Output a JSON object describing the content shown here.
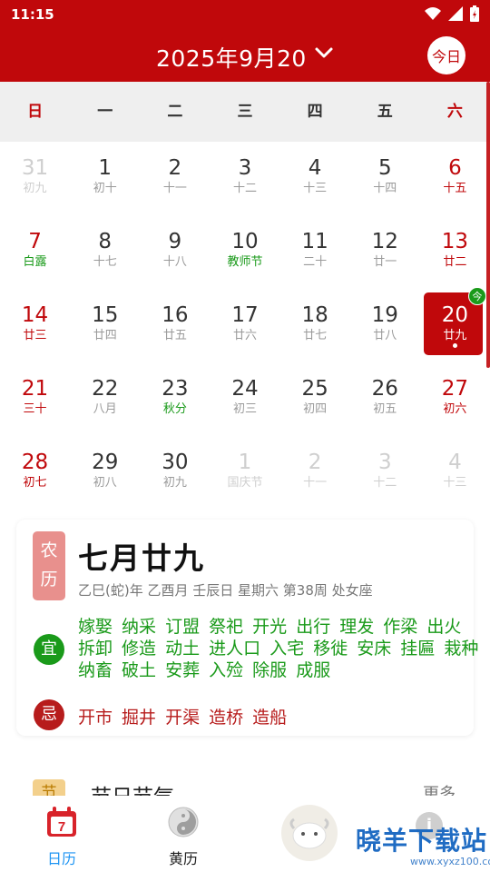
{
  "status_bar": {
    "time": "11:15",
    "icons": [
      "wifi-icon",
      "signal-icon",
      "battery-icon"
    ]
  },
  "header": {
    "title": "2025年9月20",
    "today_button": "今日"
  },
  "weekdays": [
    {
      "label": "日",
      "weekend": true
    },
    {
      "label": "一",
      "weekend": false
    },
    {
      "label": "二",
      "weekend": false
    },
    {
      "label": "三",
      "weekend": false
    },
    {
      "label": "四",
      "weekend": false
    },
    {
      "label": "五",
      "weekend": false
    },
    {
      "label": "六",
      "weekend": true
    }
  ],
  "calendar": {
    "weeks": [
      [
        {
          "day": "31",
          "lunar": "初九",
          "type": "other"
        },
        {
          "day": "1",
          "lunar": "初十",
          "type": "normal"
        },
        {
          "day": "2",
          "lunar": "十一",
          "type": "normal"
        },
        {
          "day": "3",
          "lunar": "十二",
          "type": "normal"
        },
        {
          "day": "4",
          "lunar": "十三",
          "type": "normal"
        },
        {
          "day": "5",
          "lunar": "十四",
          "type": "normal"
        },
        {
          "day": "6",
          "lunar": "十五",
          "type": "weekend"
        }
      ],
      [
        {
          "day": "7",
          "lunar": "白露",
          "type": "weekend-festival"
        },
        {
          "day": "8",
          "lunar": "十七",
          "type": "normal"
        },
        {
          "day": "9",
          "lunar": "十八",
          "type": "normal"
        },
        {
          "day": "10",
          "lunar": "教师节",
          "type": "festival"
        },
        {
          "day": "11",
          "lunar": "二十",
          "type": "normal"
        },
        {
          "day": "12",
          "lunar": "廿一",
          "type": "normal"
        },
        {
          "day": "13",
          "lunar": "廿二",
          "type": "weekend"
        }
      ],
      [
        {
          "day": "14",
          "lunar": "廿三",
          "type": "weekend"
        },
        {
          "day": "15",
          "lunar": "廿四",
          "type": "normal"
        },
        {
          "day": "16",
          "lunar": "廿五",
          "type": "normal"
        },
        {
          "day": "17",
          "lunar": "廿六",
          "type": "normal"
        },
        {
          "day": "18",
          "lunar": "廿七",
          "type": "normal"
        },
        {
          "day": "19",
          "lunar": "廿八",
          "type": "normal"
        },
        {
          "day": "20",
          "lunar": "廿九",
          "type": "selected",
          "badge": "今"
        }
      ],
      [
        {
          "day": "21",
          "lunar": "三十",
          "type": "weekend"
        },
        {
          "day": "22",
          "lunar": "八月",
          "type": "normal"
        },
        {
          "day": "23",
          "lunar": "秋分",
          "type": "festival"
        },
        {
          "day": "24",
          "lunar": "初三",
          "type": "normal"
        },
        {
          "day": "25",
          "lunar": "初四",
          "type": "normal"
        },
        {
          "day": "26",
          "lunar": "初五",
          "type": "normal"
        },
        {
          "day": "27",
          "lunar": "初六",
          "type": "weekend"
        }
      ],
      [
        {
          "day": "28",
          "lunar": "初七",
          "type": "weekend"
        },
        {
          "day": "29",
          "lunar": "初八",
          "type": "normal"
        },
        {
          "day": "30",
          "lunar": "初九",
          "type": "normal"
        },
        {
          "day": "1",
          "lunar": "国庆节",
          "type": "other"
        },
        {
          "day": "2",
          "lunar": "十一",
          "type": "other"
        },
        {
          "day": "3",
          "lunar": "十二",
          "type": "other"
        },
        {
          "day": "4",
          "lunar": "十三",
          "type": "other"
        }
      ]
    ]
  },
  "detail": {
    "tag": "农历",
    "lunar_date": "七月廿九",
    "subtitle": "乙巳(蛇)年 乙酉月 壬辰日  星期六 第38周 处女座",
    "yi_label": "宜",
    "yi_text": "嫁娶 纳采 订盟 祭祀 开光 出行 理发 作梁 出火 拆卸 修造 动土 进人口 入宅 移徙 安床 挂匾 栽种 纳畜 破土 安葬 入殓 除服 成服",
    "ji_label": "忌",
    "ji_text": "开市 掘井 开渠 造桥 造船"
  },
  "section2": {
    "tag": "节",
    "title": "节日节气",
    "more": "更多"
  },
  "tabbar": {
    "calendar_label": "日历",
    "calendar_icon_day": "7",
    "huangli_label": "黄历",
    "watermark": "晓羊下载站",
    "watermark_url": "www.xyxz100.com"
  },
  "colors": {
    "accent": "#c0080b",
    "green": "#1a9a1a",
    "tab_active": "#2196f3"
  }
}
